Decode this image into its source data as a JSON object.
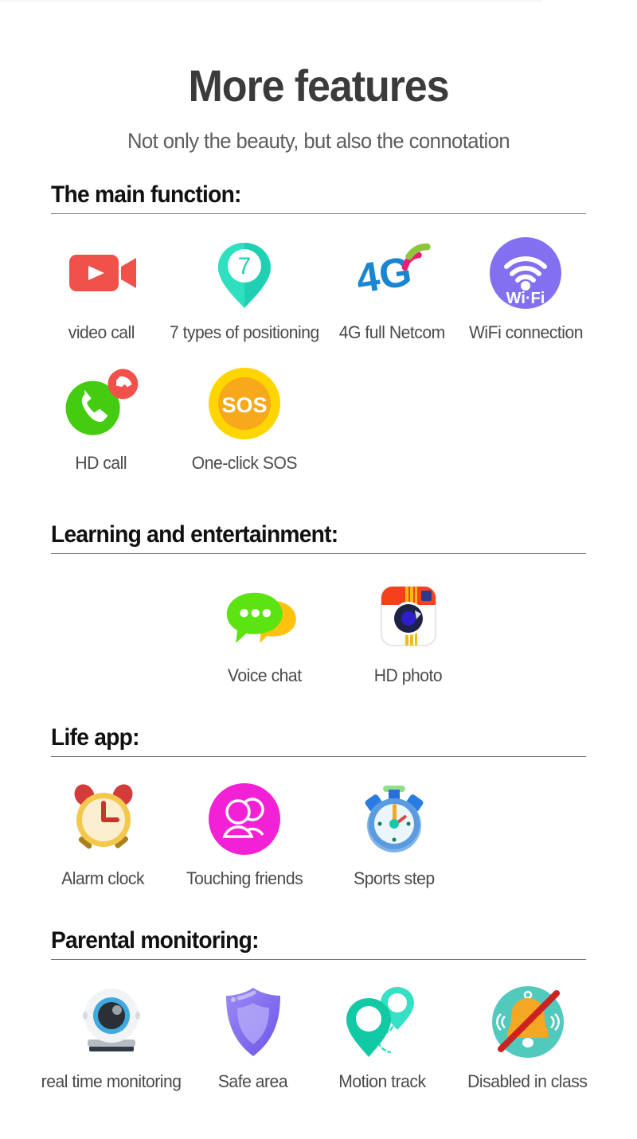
{
  "header": {
    "title": "More features",
    "subtitle": "Not only the beauty, but also the connotation"
  },
  "colors": {
    "title_gray": "#3b3b3b",
    "subtitle_gray": "#5d5d5d",
    "heading_black": "#111111",
    "rule_gray": "#777777",
    "caption_gray": "#4a4a4a",
    "red": "#F0524B",
    "teal": "#1FD1B2",
    "teal_light": "#35E0C4",
    "blue_4g": "#1B86D0",
    "pink": "#EC1C74",
    "green_arc": "#8CC63F",
    "purple": "#8270F0",
    "green": "#44CC11",
    "yellow": "#FFD500",
    "orange": "#F7A81B",
    "bubble_green": "#5BE312",
    "bubble_yellow": "#FFC20E",
    "camera_red": "#F4411C",
    "camera_yellow": "#F5BA18",
    "lens_navy": "#1E2246",
    "lens_blue": "#2D1FCB",
    "clock_yellow": "#F2C94C",
    "clock_face": "#FBEFD0",
    "clock_red": "#D63B3B",
    "magenta": "#F321D6",
    "stopwatch_blue": "#4A90E2",
    "webcam_blue": "#3FA9E0",
    "shield_purple": "#8A7BF0",
    "circle_teal": "#52C9BD",
    "bell_orange": "#F5A623",
    "strike_red": "#CC2222"
  },
  "sections": [
    {
      "id": "main-function",
      "heading": "The main function:",
      "rows": [
        [
          {
            "label": "video call",
            "icon": "video-camera-icon"
          },
          {
            "label": "7 types of positioning",
            "icon": "location-pin-7-icon",
            "badge": "7"
          },
          {
            "label": "4G full Netcom",
            "icon": "four-g-signal-icon",
            "text": "4G"
          },
          {
            "label": "WiFi connection",
            "icon": "wifi-icon",
            "text": "Wi·Fi"
          }
        ],
        [
          {
            "label": "HD call",
            "icon": "phone-call-icon"
          },
          {
            "label": "One-click SOS",
            "icon": "sos-icon",
            "text": "SOS"
          }
        ]
      ]
    },
    {
      "id": "learning-entertainment",
      "heading": "Learning and entertainment:",
      "rows": [
        [
          {
            "label": "Voice chat",
            "icon": "speech-bubble-icon"
          },
          {
            "label": "HD photo",
            "icon": "camera-app-icon"
          }
        ]
      ]
    },
    {
      "id": "life-app",
      "heading": "Life app:",
      "rows": [
        [
          {
            "label": "Alarm clock",
            "icon": "alarm-clock-icon"
          },
          {
            "label": "Touching friends",
            "icon": "friends-icon"
          },
          {
            "label": "Sports step",
            "icon": "stopwatch-icon"
          }
        ]
      ]
    },
    {
      "id": "parental-monitoring",
      "heading": "Parental monitoring:",
      "rows": [
        [
          {
            "label": "real time monitoring",
            "icon": "webcam-icon"
          },
          {
            "label": "Safe area",
            "icon": "shield-icon"
          },
          {
            "label": "Motion track",
            "icon": "motion-track-pins-icon"
          },
          {
            "label": "Disabled in class",
            "icon": "bell-disabled-icon"
          }
        ]
      ]
    }
  ]
}
